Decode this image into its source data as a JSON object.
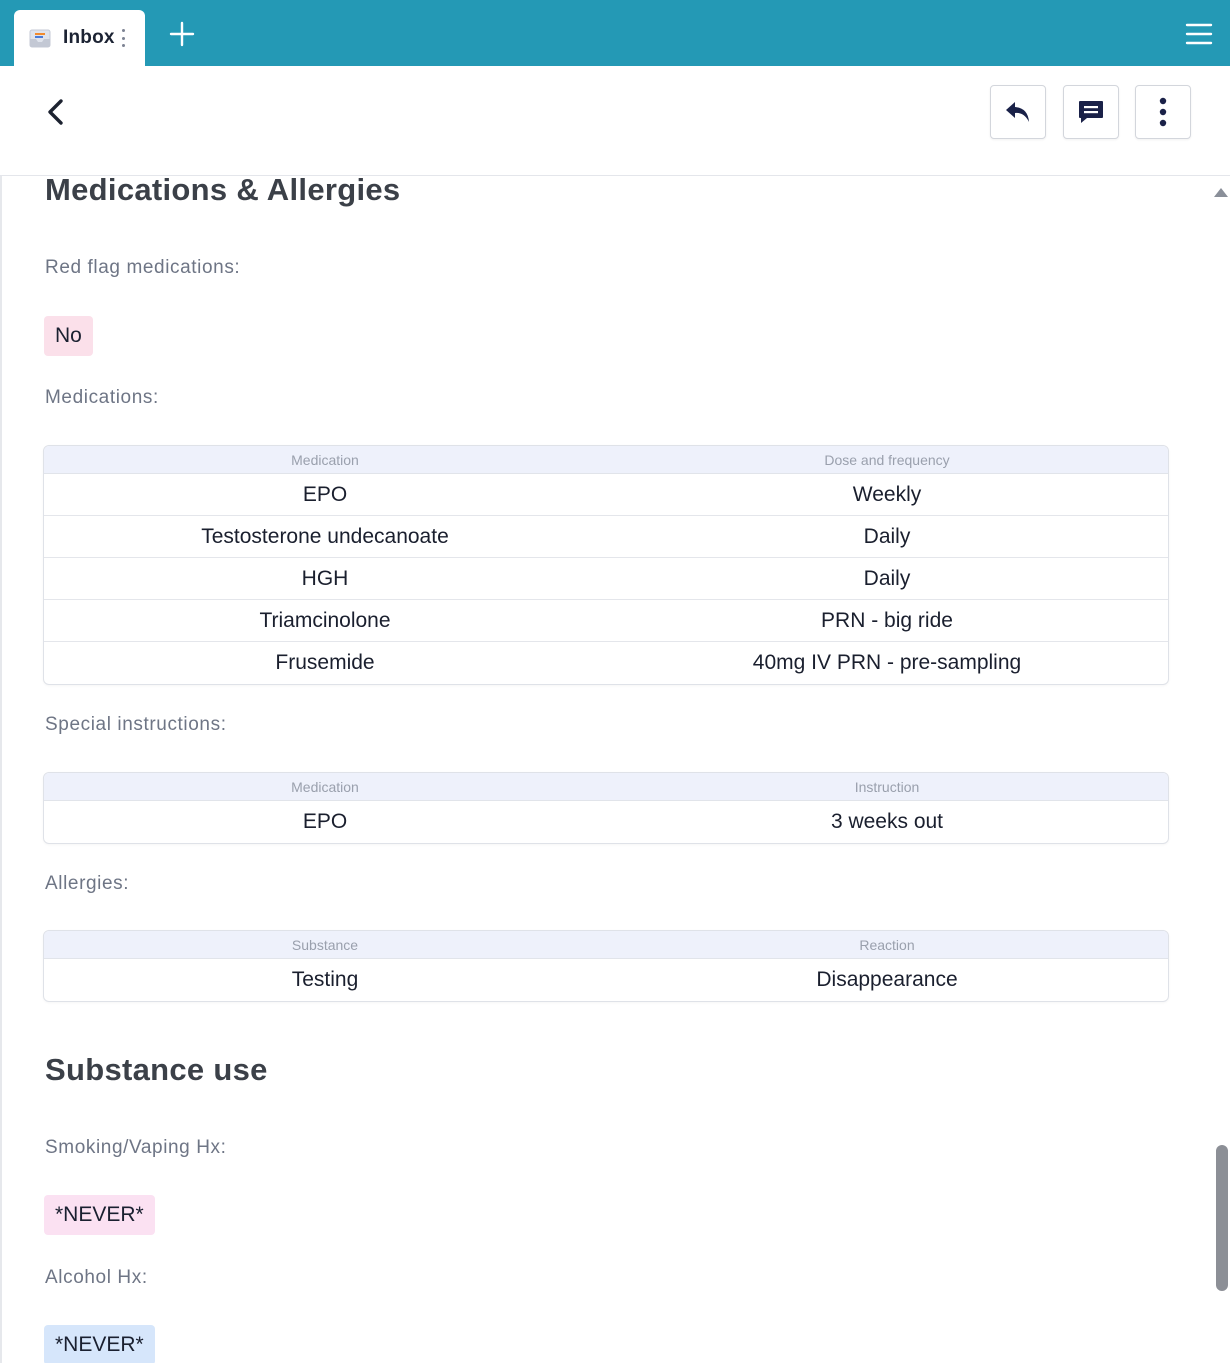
{
  "tabs": [
    {
      "label": "Inbox",
      "icon": "inbox-app-icon"
    }
  ],
  "toolbar": {
    "back_icon": "chevron-left-icon",
    "actions": [
      {
        "name": "reply",
        "icon": "reply-icon"
      },
      {
        "name": "comment",
        "icon": "comment-icon"
      },
      {
        "name": "more",
        "icon": "kebab-menu-icon"
      }
    ]
  },
  "medications_allergies": {
    "heading": "Medications & Allergies",
    "red_flag": {
      "label": "Red flag medications:",
      "value": "No"
    },
    "medications": {
      "label": "Medications:",
      "columns": [
        "Medication",
        "Dose and frequency"
      ],
      "rows": [
        [
          "EPO",
          "Weekly"
        ],
        [
          "Testosterone undecanoate",
          "Daily"
        ],
        [
          "HGH",
          "Daily"
        ],
        [
          "Triamcinolone",
          "PRN - big ride"
        ],
        [
          "Frusemide",
          "40mg IV PRN - pre-sampling"
        ]
      ]
    },
    "special_instructions": {
      "label": "Special instructions:",
      "columns": [
        "Medication",
        "Instruction"
      ],
      "rows": [
        [
          "EPO",
          "3 weeks out"
        ]
      ]
    },
    "allergies": {
      "label": "Allergies:",
      "columns": [
        "Substance",
        "Reaction"
      ],
      "rows": [
        [
          "Testing",
          "Disappearance"
        ]
      ]
    }
  },
  "substance_use": {
    "heading": "Substance use",
    "smoking": {
      "label": "Smoking/Vaping Hx:",
      "value": "*NEVER*"
    },
    "alcohol": {
      "label": "Alcohol Hx:",
      "value": "*NEVER*"
    }
  },
  "colors": {
    "tab_bar": "#2499b5",
    "chip_no": "#fbe0ea",
    "chip_smoking": "#fbe1f2",
    "chip_alcohol": "#d6e6fb",
    "table_header": "#eef1fb"
  }
}
